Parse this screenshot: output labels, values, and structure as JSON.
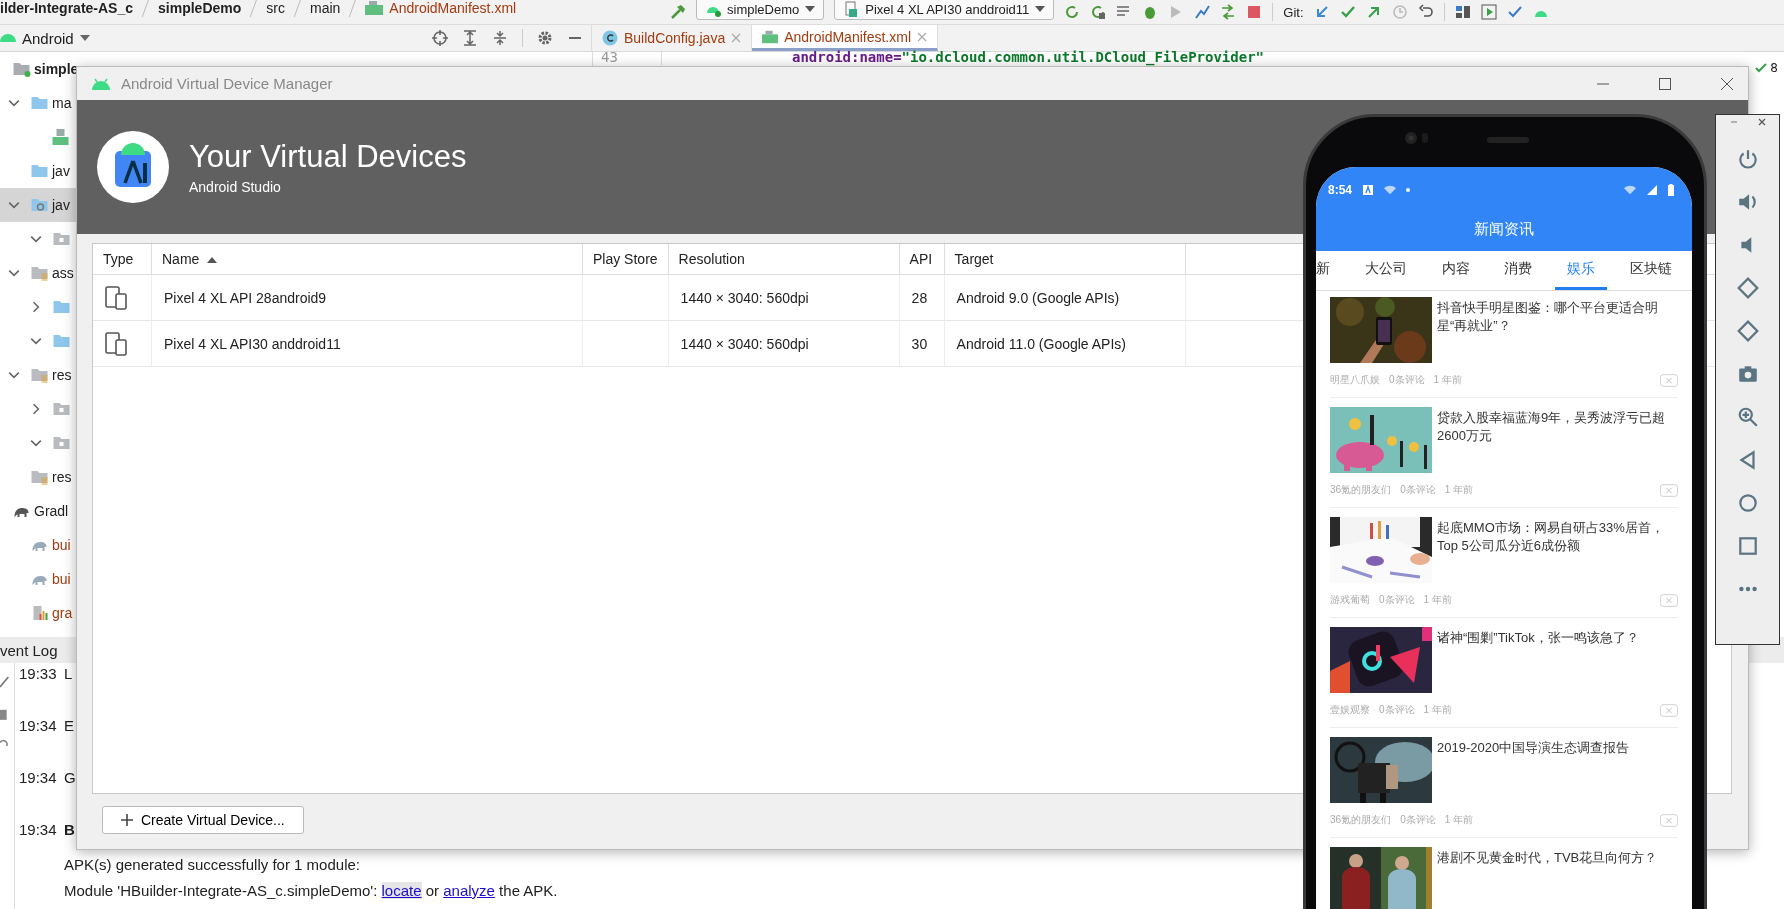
{
  "breadcrumb": [
    {
      "label": "ilder-Integrate-AS_c",
      "bold": true,
      "kind": "folder"
    },
    {
      "label": "simpleDemo",
      "bold": true,
      "kind": "folder"
    },
    {
      "label": "src",
      "bold": false,
      "kind": "folder"
    },
    {
      "label": "main",
      "bold": false,
      "kind": "folder"
    },
    {
      "label": "AndroidManifest.xml",
      "bold": false,
      "kind": "manifest"
    }
  ],
  "toolbar": {
    "run_config": "simpleDemo",
    "device": "Pixel 4 XL API30 anddroid11",
    "git_label": "Git:"
  },
  "project_panel": {
    "view": "Android",
    "tree": [
      {
        "label": "simple",
        "kind": "module",
        "selected": false,
        "children": [
          {
            "label": "ma",
            "kind": "folder",
            "expanded": true,
            "selected": false,
            "children": [
              {
                "kind": "manifest",
                "selected": false
              }
            ]
          },
          {
            "label": "jav",
            "kind": "folder",
            "selected": false
          },
          {
            "label": "jav",
            "kind": "java-folder",
            "expanded": true,
            "selected": true,
            "children": [
              {
                "kind": "package",
                "expanded": true,
                "selected": false
              }
            ]
          },
          {
            "label": "ass",
            "kind": "res-folder",
            "expanded": true,
            "selected": false,
            "children": [
              {
                "kind": "folder",
                "expanded": false,
                "selected": false
              },
              {
                "kind": "folder",
                "expanded": true,
                "selected": false
              }
            ]
          },
          {
            "label": "res",
            "kind": "res-folder",
            "expanded": true,
            "selected": false,
            "children": [
              {
                "kind": "package",
                "expanded": false,
                "selected": false
              },
              {
                "kind": "package",
                "expanded": true,
                "selected": false
              }
            ]
          },
          {
            "label": "res",
            "kind": "res-folder",
            "selected": false
          }
        ]
      },
      {
        "label": "Gradl",
        "kind": "gradle",
        "selected": false,
        "children": [
          {
            "label": "bui",
            "kind": "gradle-file",
            "selected": false
          },
          {
            "label": "bui",
            "kind": "gradle-file",
            "selected": false
          },
          {
            "label": "gra",
            "kind": "properties-file",
            "selected": false
          }
        ]
      }
    ]
  },
  "editor": {
    "tabs": [
      {
        "label": "BuildConfig.java",
        "kind": "class",
        "selected": false
      },
      {
        "label": "AndroidManifest.xml",
        "kind": "manifest",
        "selected": true
      }
    ],
    "line_number": "43",
    "code": [
      {
        "text": "android:name=",
        "kind": "attribute"
      },
      {
        "text": "\"io.dcloud.common.util.DCloud_FileProvider\"",
        "kind": "string"
      }
    ],
    "problems_count": "8"
  },
  "event_log": {
    "title": "vent Log",
    "entries": [
      {
        "time": "19:33",
        "text": "L",
        "bold": false
      },
      {
        "time": "19:34",
        "text": "E",
        "bold": false
      },
      {
        "time": "19:34",
        "text": "G",
        "bold": false
      },
      {
        "time": "19:34",
        "text": "B",
        "bold": true,
        "details": [
          [
            {
              "text": "APK(s) generated successfully for 1 module:",
              "kind": "plain"
            }
          ],
          [
            {
              "text": "Module 'HBuilder-Integrate-AS_c.simpleDemo': ",
              "kind": "plain"
            },
            {
              "text": "locate",
              "kind": "link",
              "highlighted": true
            },
            {
              "text": " or ",
              "kind": "plain"
            },
            {
              "text": "analyze",
              "kind": "link",
              "highlighted": false
            },
            {
              "text": " the APK.",
              "kind": "plain"
            }
          ]
        ]
      }
    ]
  },
  "avd": {
    "title": "Android Virtual Device Manager",
    "heading": "Your Virtual Devices",
    "subheading": "Android Studio",
    "columns": [
      {
        "label": "Type",
        "sorted": false
      },
      {
        "label": "Name",
        "sorted": true
      },
      {
        "label": "Play Store",
        "sorted": false
      },
      {
        "label": "Resolution",
        "sorted": false
      },
      {
        "label": "API",
        "sorted": false
      },
      {
        "label": "Target",
        "sorted": false
      }
    ],
    "rows": [
      {
        "name": "Pixel 4 XL API 28android9",
        "resolution": "1440 × 3040: 560dpi",
        "api": "28",
        "target": "Android 9.0 (Google APIs)"
      },
      {
        "name": "Pixel 4 XL API30 anddroid11",
        "resolution": "1440 × 3040: 560dpi",
        "api": "30",
        "target": "Android 11.0 (Google APIs)"
      }
    ],
    "create_button": "Create Virtual Device..."
  },
  "emulator": {
    "status_time": "8:54",
    "app_title": "新闻资讯",
    "tabs": [
      {
        "label": "新",
        "selected": false
      },
      {
        "label": "大公司",
        "selected": false
      },
      {
        "label": "内容",
        "selected": false
      },
      {
        "label": "消费",
        "selected": false
      },
      {
        "label": "娱乐",
        "selected": true
      },
      {
        "label": "区块链",
        "selected": false
      }
    ],
    "articles": [
      {
        "title": "抖音快手明星图鉴：哪个平台更适合明星“再就业”？",
        "source": "明星八爪娱",
        "comments": "0条评论",
        "time": "1 年前"
      },
      {
        "title": "贷款入股幸福蓝海9年，吴秀波浮亏已超2600万元",
        "source": "36氪的朋友们",
        "comments": "0条评论",
        "time": "1 年前"
      },
      {
        "title": "起底MMO市场：网易自研占33%居首，Top 5公司瓜分近6成份额",
        "source": "游戏葡萄",
        "comments": "0条评论",
        "time": "1 年前"
      },
      {
        "title": "诸神“围剿”TikTok，张一鸣该急了？",
        "source": "壹娱观察",
        "comments": "0条评论",
        "time": "1 年前"
      },
      {
        "title": "2019-2020中国导演生态调查报告",
        "source": "36氪的朋友们",
        "comments": "0条评论",
        "time": "1 年前"
      },
      {
        "title": "港剧不见黄金时代，TVB花旦向何方？"
      }
    ]
  }
}
